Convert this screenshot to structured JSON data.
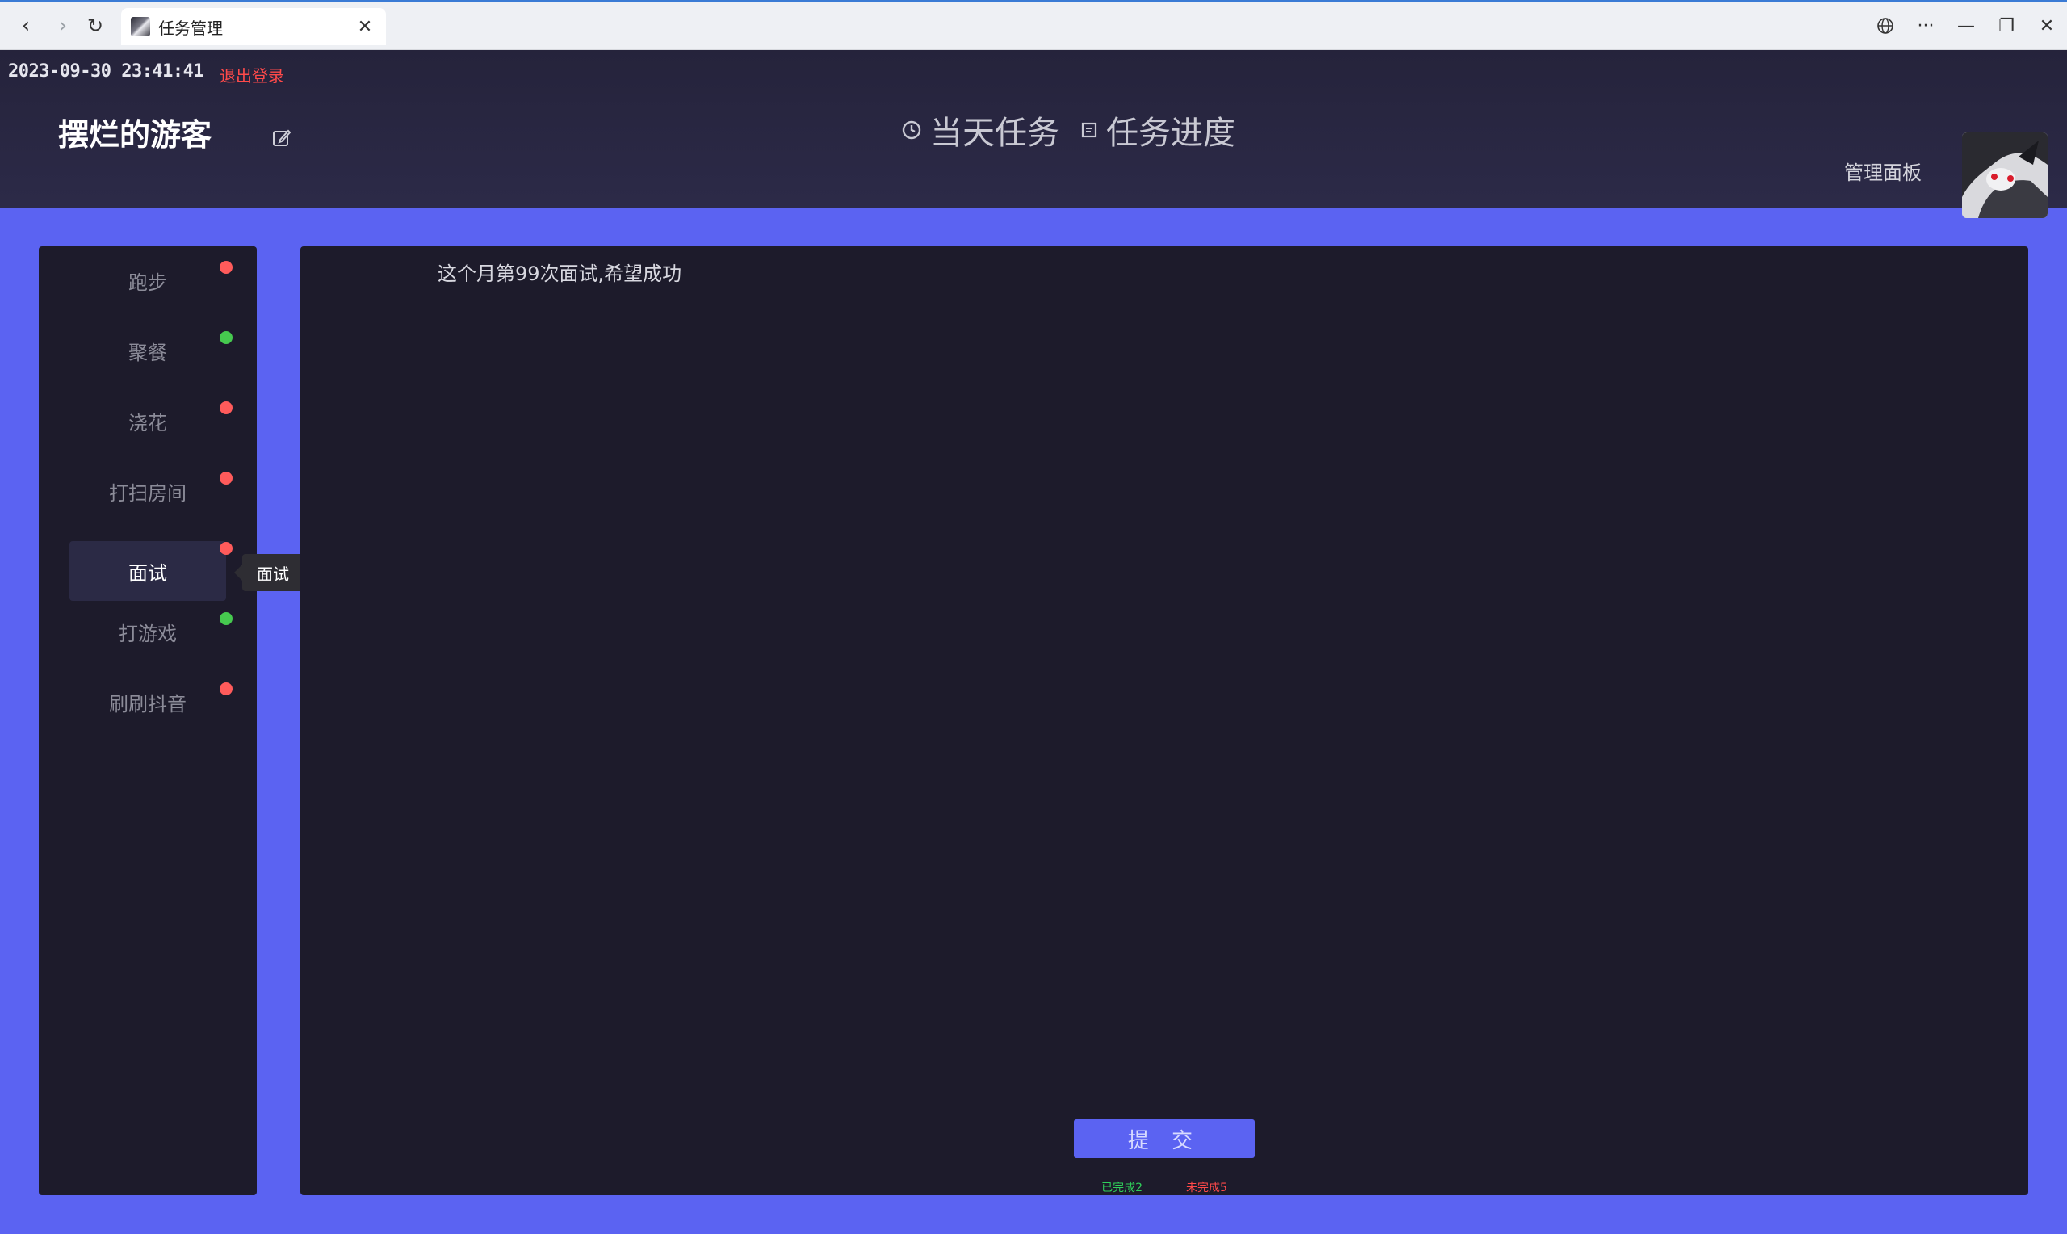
{
  "browser": {
    "tab_title": "任务管理",
    "tab_close": "✕",
    "back": "‹",
    "forward": "›",
    "reload": "↻",
    "globe": "🌐",
    "more": "···",
    "minimize": "—",
    "restore": "❐",
    "close": "✕"
  },
  "header": {
    "datetime": "2023-09-30 23:41:41",
    "logout_label": "退出登录",
    "username": "摆烂的游客",
    "nav": {
      "today_tasks": "当天任务",
      "task_progress": "任务进度"
    },
    "admin_panel": "管理面板"
  },
  "sidebar": {
    "tasks": [
      {
        "label": "跑步",
        "status": "incomplete"
      },
      {
        "label": "聚餐",
        "status": "complete"
      },
      {
        "label": "浇花",
        "status": "incomplete"
      },
      {
        "label": "打扫房间",
        "status": "incomplete"
      },
      {
        "label": "面试",
        "status": "incomplete",
        "active": true
      },
      {
        "label": "打游戏",
        "status": "complete"
      },
      {
        "label": "刷刷抖音",
        "status": "incomplete"
      }
    ],
    "tooltip": "面试"
  },
  "main": {
    "description": "这个月第99次面试,希望成功",
    "submit_label": "提 交",
    "completed_text": "已完成2",
    "incomplete_text": "未完成5"
  },
  "colors": {
    "complete": "#46c94f",
    "incomplete": "#ff5b5b",
    "accent": "#5b63f2",
    "panel": "#1d1b2b",
    "header": "#26243d"
  }
}
